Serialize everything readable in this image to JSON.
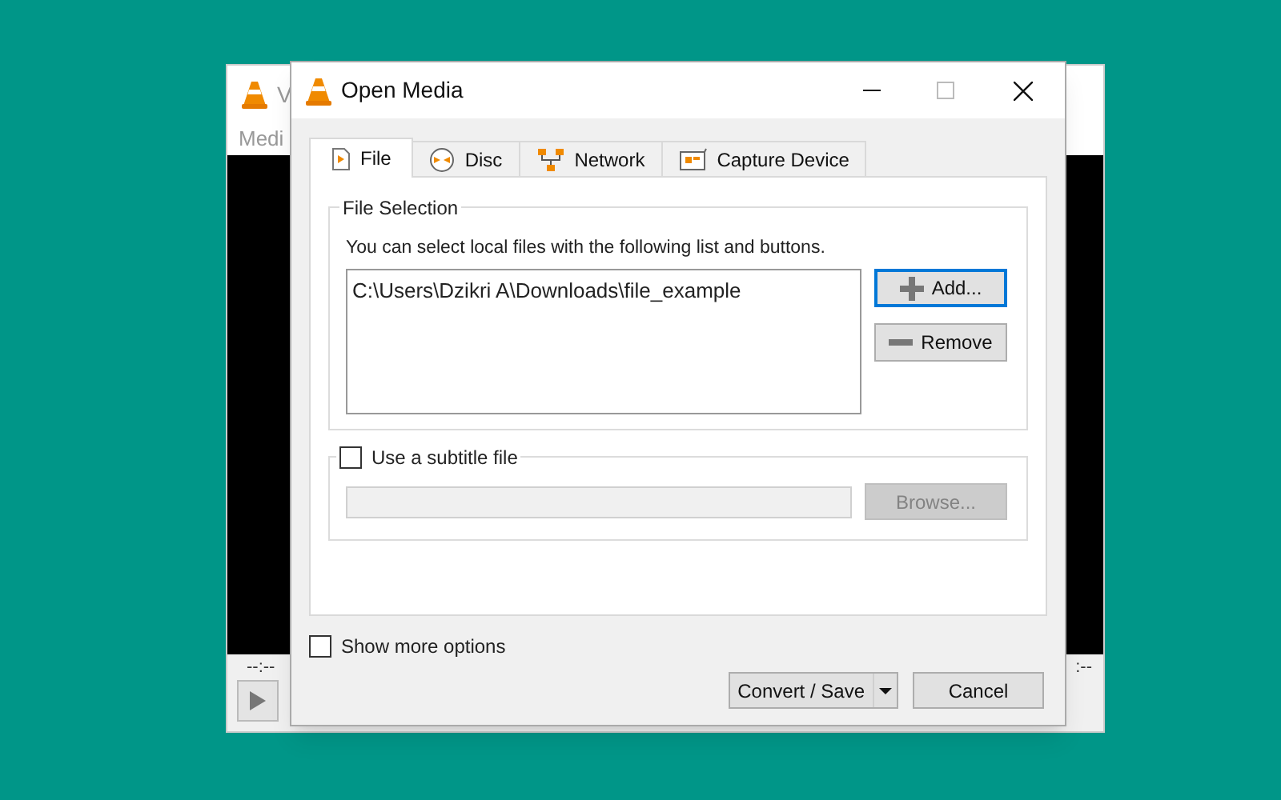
{
  "background_window": {
    "title": "V",
    "menu": [
      "Medi"
    ],
    "time_left": "--:--",
    "time_right": ":--"
  },
  "dialog": {
    "title": "Open Media",
    "tabs": [
      {
        "label": "File",
        "kind": "file",
        "selected": true
      },
      {
        "label": "Disc",
        "kind": "disc",
        "selected": false
      },
      {
        "label": "Network",
        "kind": "network",
        "selected": false
      },
      {
        "label": "Capture Device",
        "kind": "capture",
        "selected": false
      }
    ],
    "file_selection": {
      "legend": "File Selection",
      "hint": "You can select local files with the following list and buttons.",
      "files": [
        "C:\\Users\\Dzikri A\\Downloads\\file_example"
      ],
      "add_button": "Add...",
      "remove_button": "Remove"
    },
    "subtitle": {
      "label": "Use a subtitle file",
      "checked": false,
      "browse_button": "Browse...",
      "disabled": true
    },
    "show_more": {
      "label": "Show more options",
      "checked": false
    },
    "convert_button": "Convert / Save",
    "cancel_button": "Cancel"
  }
}
